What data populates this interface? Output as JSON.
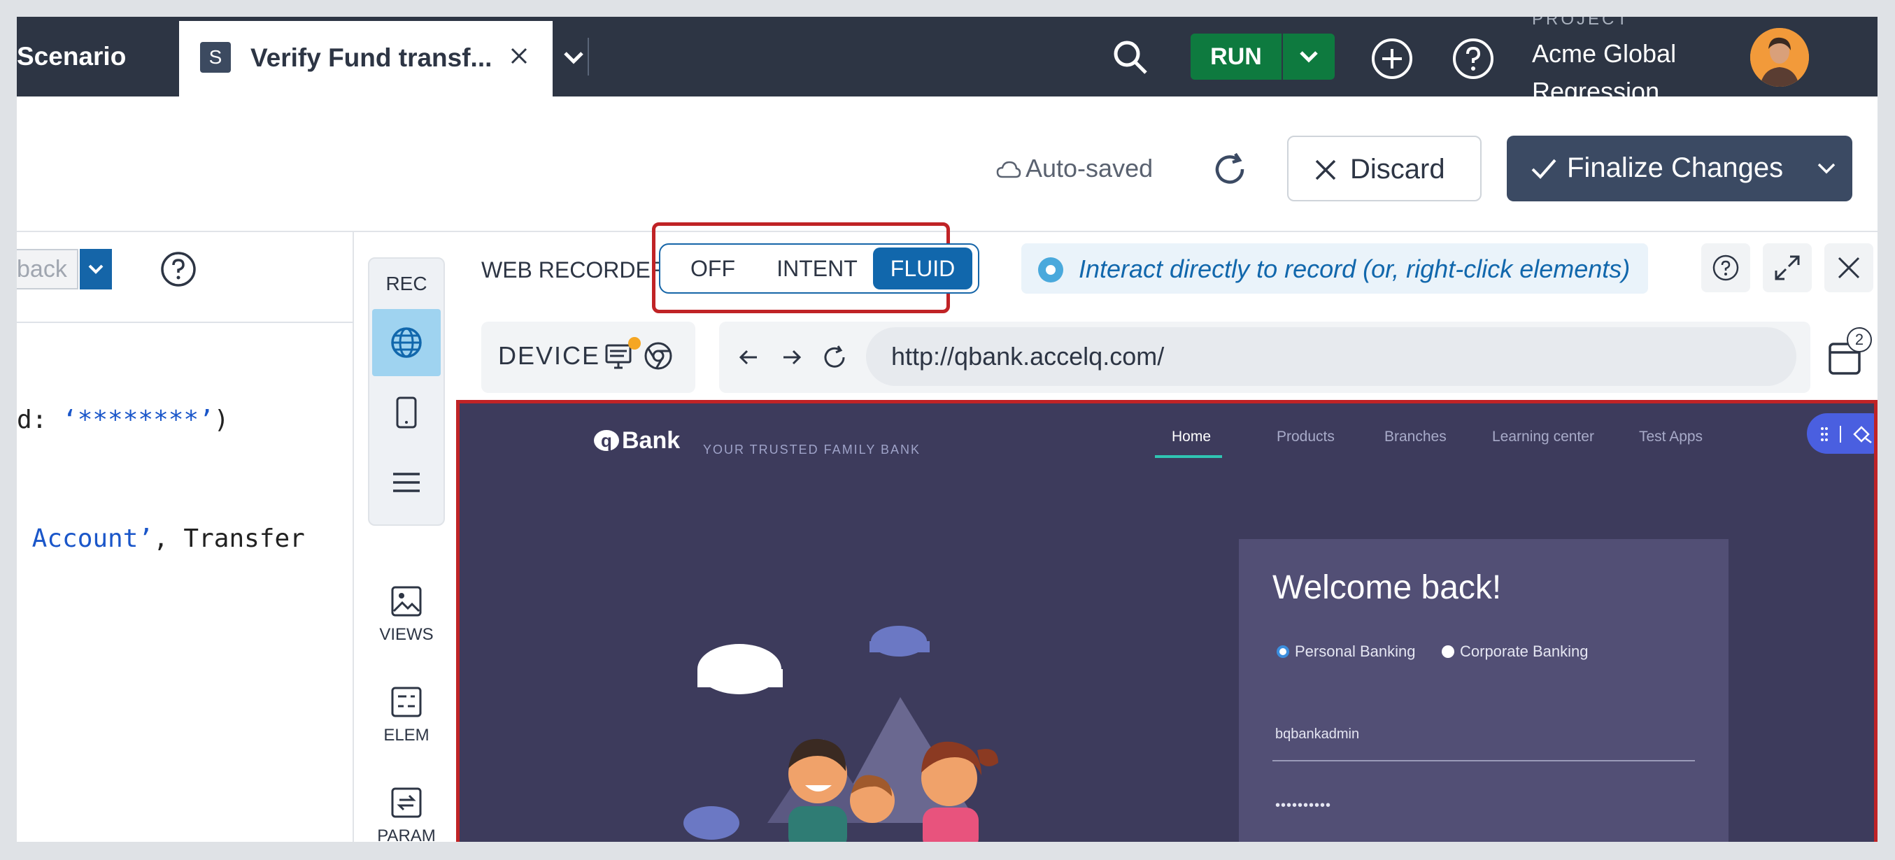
{
  "topbar": {
    "scenario_label": "Scenario",
    "tab_badge": "S",
    "tab_title": "Verify Fund transf...",
    "run_label": "RUN",
    "project_caption": "PROJECT",
    "project_name": "Acme Global Regression"
  },
  "actions": {
    "autosaved": "Auto-saved",
    "discard": "Discard",
    "finalize": "Finalize Changes"
  },
  "left_panel": {
    "back_input_value": "back",
    "code": {
      "line1_prefix": "d: ",
      "line1_value": "‘********’",
      "line1_suffix": ")",
      "line2_value": " Account’",
      "line2_suffix": ", Transfer"
    }
  },
  "side_tools": {
    "rec_label": "REC",
    "views": "VIEWS",
    "elem": "ELEM",
    "param": "PARAM"
  },
  "recorder": {
    "title": "WEB RECORDER",
    "modes": [
      "OFF",
      "INTENT",
      "FLUID"
    ],
    "active_mode": "FLUID",
    "hint": "Interact directly to record (or, right-click elements)",
    "device_label": "DEVICE",
    "url": "http://qbank.accelq.com/",
    "tab_count": "2"
  },
  "bank_page": {
    "logo": "Bank",
    "logo_mark": "q",
    "tagline": "YOUR TRUSTED FAMILY BANK",
    "nav": [
      "Home",
      "Products",
      "Branches",
      "Learning center",
      "Test Apps"
    ],
    "welcome": "Welcome back!",
    "radio_personal": "Personal Banking",
    "radio_corporate": "Corporate Banking",
    "username": "bqbankadmin",
    "password": "••••••••••"
  },
  "colors": {
    "topbar": "#2d3544",
    "run_green": "#0e7a3f",
    "accent_blue": "#1167ac",
    "highlight_red": "#c02326",
    "bank_bg": "#3d3b5c"
  }
}
